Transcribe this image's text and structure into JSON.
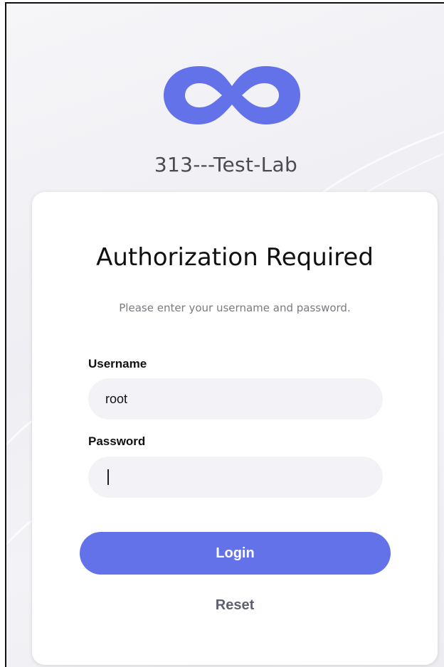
{
  "site": {
    "name": "313---Test-Lab",
    "logo_icon": "infinity-icon",
    "brand_color": "#6372e8"
  },
  "login": {
    "title": "Authorization Required",
    "subtitle": "Please enter your username and password.",
    "username_label": "Username",
    "username_value": "root",
    "password_label": "Password",
    "password_value": "",
    "login_label": "Login",
    "reset_label": "Reset"
  }
}
